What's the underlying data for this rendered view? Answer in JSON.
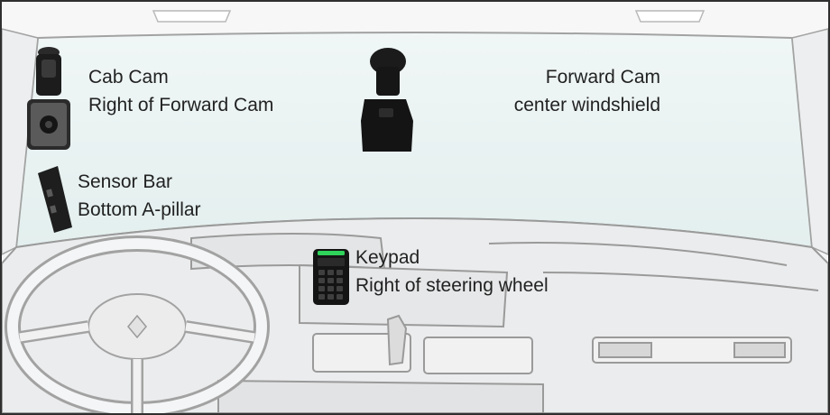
{
  "devices": {
    "cab_cam": {
      "name": "Cab Cam",
      "location": "Right of Forward Cam"
    },
    "forward_cam": {
      "name": "Forward Cam",
      "location": "center windshield"
    },
    "sensor_bar": {
      "name": "Sensor Bar",
      "location": "Bottom A-pillar"
    },
    "keypad": {
      "name": "Keypad",
      "location": "Right of steering wheel"
    }
  },
  "colors": {
    "frame": "#2f2f2f",
    "windshield": "#e8f2f1",
    "line_art": "#9a9a9a",
    "device_body": "#1c1c1c",
    "keypad_led": "#2fd35a",
    "text": "#222222"
  }
}
